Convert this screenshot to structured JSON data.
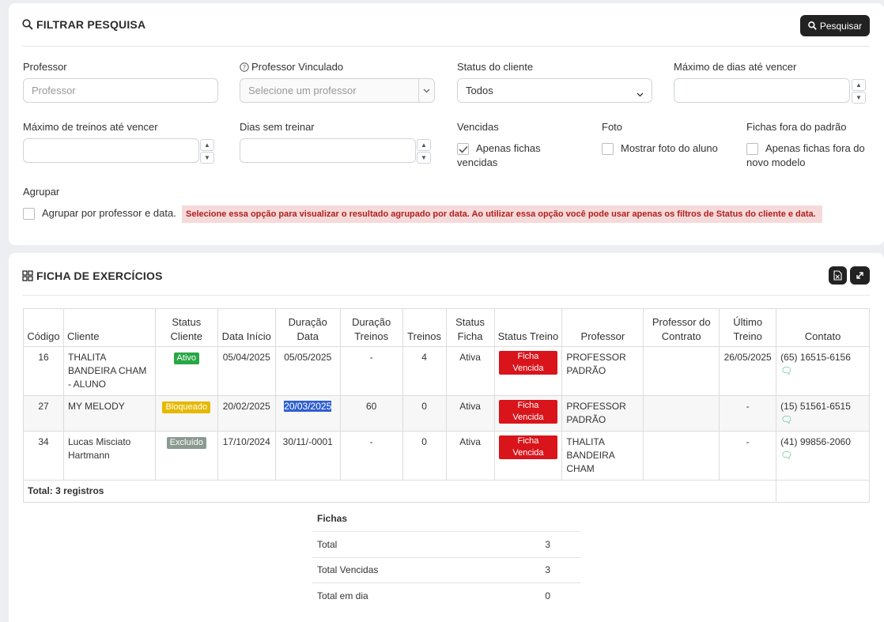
{
  "filter": {
    "title": "FILTRAR PESQUISA",
    "search_button": "Pesquisar",
    "professor": {
      "label": "Professor",
      "placeholder": "Professor"
    },
    "professor_vinculado": {
      "label": "Professor Vinculado",
      "placeholder": "Selecione um professor"
    },
    "status_cliente": {
      "label": "Status do cliente",
      "value": "Todos"
    },
    "max_dias": {
      "label": "Máximo de dias até vencer",
      "value": ""
    },
    "max_treinos": {
      "label": "Máximo de treinos até vencer",
      "value": ""
    },
    "dias_sem_treinar": {
      "label": "Dias sem treinar",
      "value": ""
    },
    "vencidas": {
      "label": "Vencidas",
      "option": "Apenas fichas vencidas",
      "checked": true
    },
    "foto": {
      "label": "Foto",
      "option": "Mostrar foto do aluno",
      "checked": false
    },
    "fichas_fora": {
      "label": "Fichas fora do padrão",
      "option": "Apenas fichas fora do novo modelo",
      "checked": false
    },
    "agrupar": {
      "label": "Agrupar",
      "option": "Agrupar por professor e data.",
      "checked": false,
      "warning": "Selecione essa opção para visualizar o resultado agrupado por data. Ao utilizar essa opção você pode usar apenas os filtros de Status do cliente e data."
    }
  },
  "results": {
    "title": "FICHA DE EXERCÍCIOS",
    "columns": [
      "Código",
      "Cliente",
      "Status Cliente",
      "Data Início",
      "Duração Data",
      "Duração Treinos",
      "Treinos",
      "Status Ficha",
      "Status Treino",
      "Professor",
      "Professor do Contrato",
      "Último Treino",
      "Contato"
    ],
    "rows": [
      {
        "codigo": "16",
        "cliente": "THALITA BANDEIRA CHAM - ALUNO",
        "status_cliente": "Ativo",
        "data_inicio": "05/04/2025",
        "duracao_data": "05/05/2025",
        "duracao_treinos": "-",
        "treinos": "4",
        "status_ficha": "Ativa",
        "status_treino": "Ficha Vencida",
        "professor": "PROFESSOR PADRÃO",
        "professor_contrato": "",
        "ultimo_treino": "26/05/2025",
        "contato": "(65) 16515-6156"
      },
      {
        "codigo": "27",
        "cliente": "MY MELODY",
        "status_cliente": "Bloqueado",
        "data_inicio": "20/02/2025",
        "duracao_data": "20/03/2025",
        "duracao_treinos": "60",
        "treinos": "0",
        "status_ficha": "Ativa",
        "status_treino": "Ficha Vencida",
        "professor": "PROFESSOR PADRÃO",
        "professor_contrato": "",
        "ultimo_treino": "-",
        "contato": "(15) 51561-6515"
      },
      {
        "codigo": "34",
        "cliente": "Lucas Misciato Hartmann",
        "status_cliente": "Excluído",
        "data_inicio": "17/10/2024",
        "duracao_data": "30/11/-0001",
        "duracao_treinos": "-",
        "treinos": "0",
        "status_ficha": "Ativa",
        "status_treino": "Ficha Vencida",
        "professor": "THALITA BANDEIRA CHAM",
        "professor_contrato": "",
        "ultimo_treino": "-",
        "contato": "(41) 99856-2060"
      }
    ],
    "total": "Total: 3 registros"
  },
  "summary": {
    "header": "Fichas",
    "rows": [
      {
        "label": "Total",
        "value": "3"
      },
      {
        "label": "Total Vencidas",
        "value": "3"
      },
      {
        "label": "Total em dia",
        "value": "0"
      }
    ]
  }
}
